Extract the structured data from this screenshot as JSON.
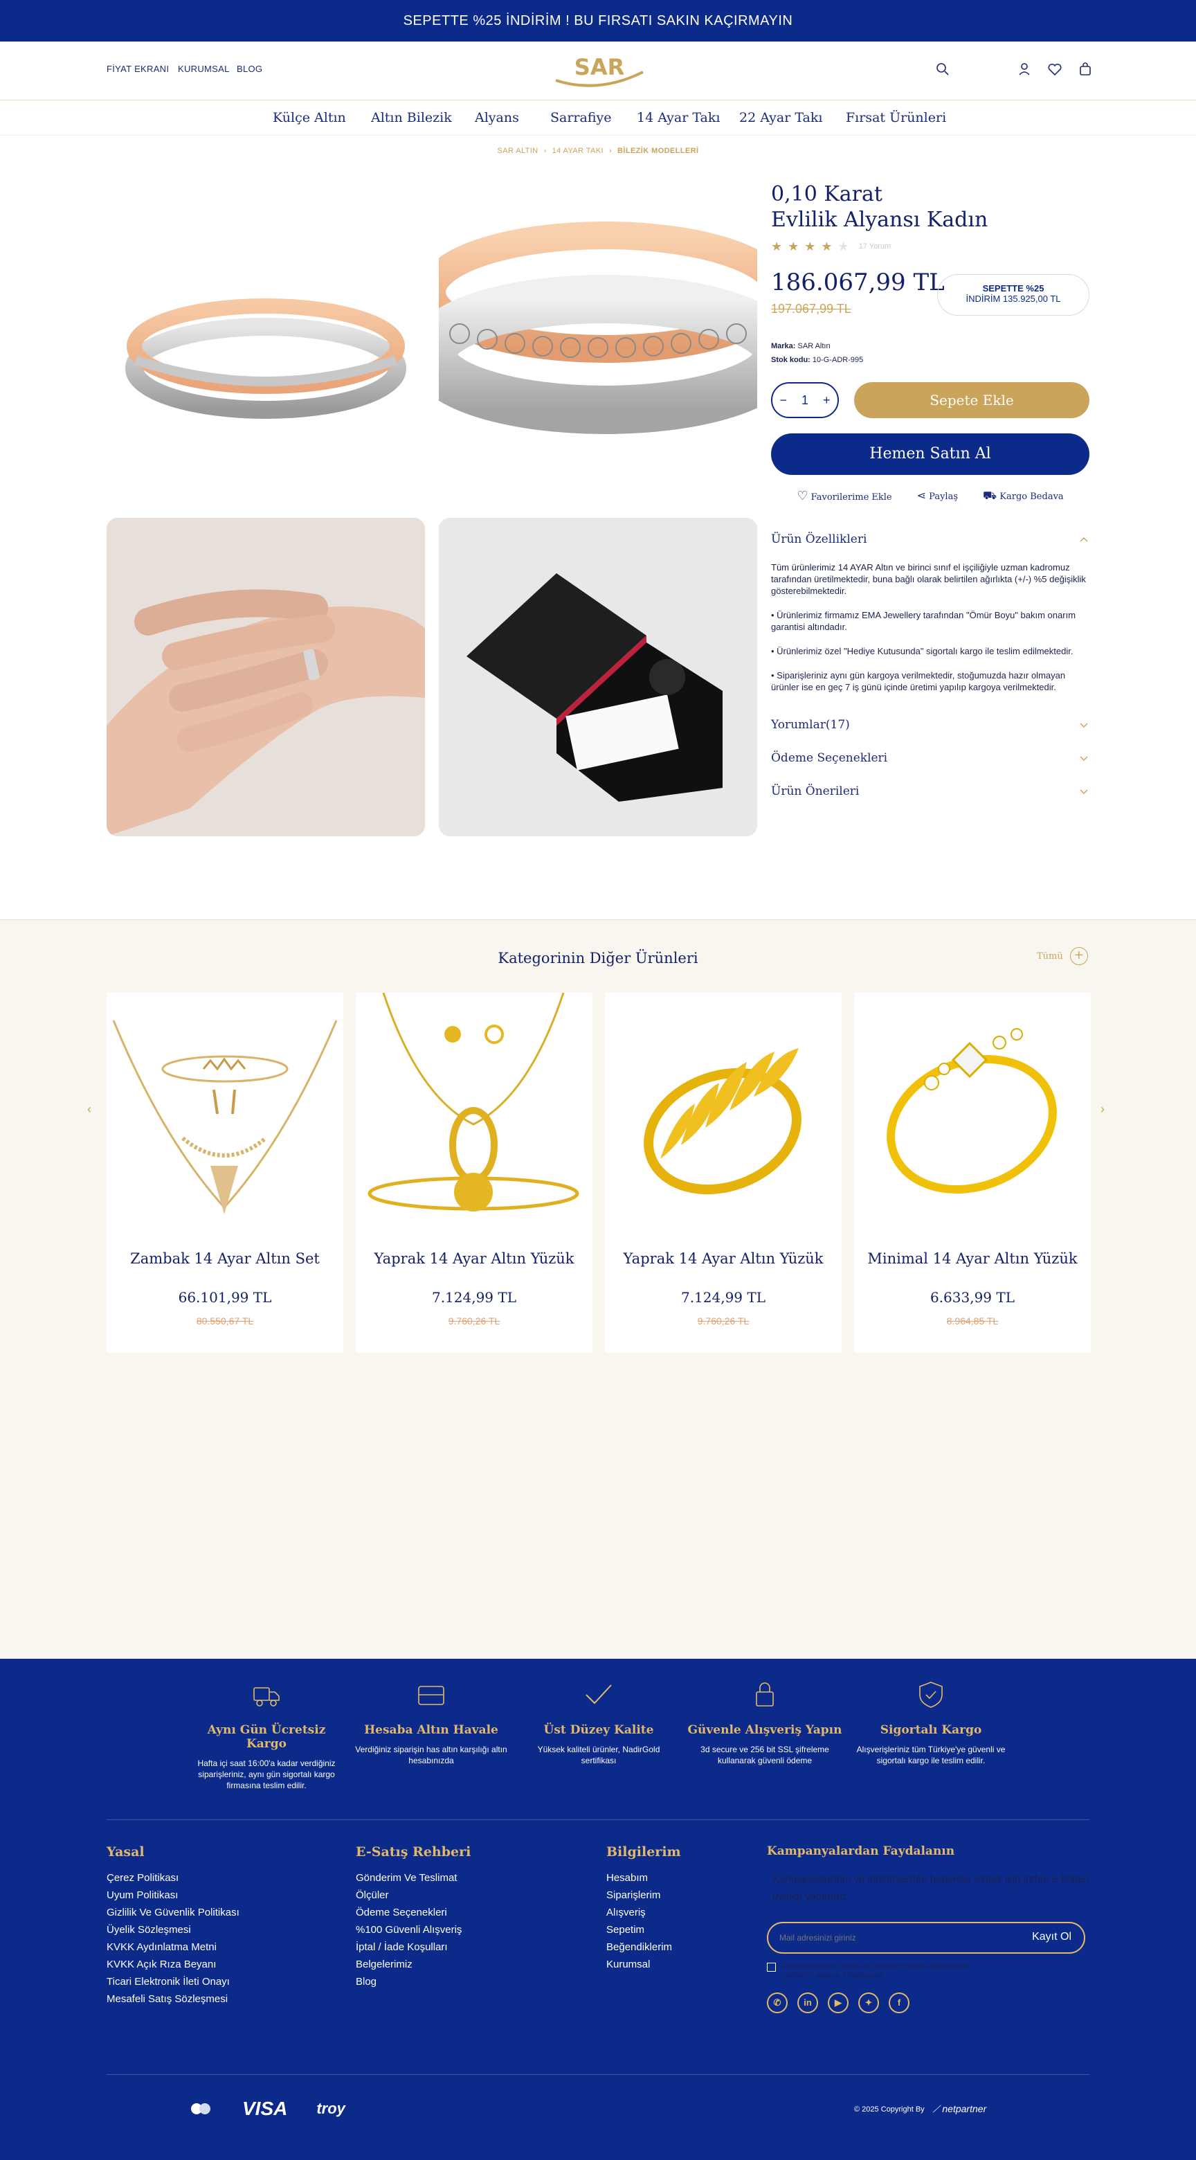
{
  "topbar": {
    "text": "SEPETTE %25 İNDİRİM ! BU FIRSATI SAKIN KAÇIRMAYIN"
  },
  "header": {
    "links": [
      "FİYAT EKRANI",
      "KURUMSAL",
      "BLOG"
    ],
    "logo_text": "SAR"
  },
  "nav": [
    "Külçe Altın",
    "Altın Bilezik",
    "Alyans",
    "Sarrafiye",
    "14 Ayar Takı",
    "22 Ayar Takı",
    "Fırsat Ürünleri"
  ],
  "breadcrumb": [
    "SAR ALTIN",
    "14 AYAR TAKI",
    "BİLEZİK MODELLERİ"
  ],
  "product": {
    "title_line1": "0,10 Karat",
    "title_line2": "Evlilik Alyansı Kadın",
    "rating": 4,
    "review_count": "17 Yorum",
    "price": "186.067,99 TL",
    "old_price": "197.067,99 TL",
    "discount_line1": "SEPETTE %25",
    "discount_line2": "İNDİRİM 135.925,00 TL",
    "brand_label": "Marka:",
    "brand": "SAR Altın",
    "sku_label": "Stok kodu:",
    "sku": "10-G-ADR-995",
    "qty": "1",
    "minus": "−",
    "plus": "+",
    "add_to_cart": "Sepete Ekle",
    "buy_now": "Hemen Satın Al",
    "fav": "Favorilerime Ekle",
    "share": "Paylaş",
    "shipping": "Kargo Bedava"
  },
  "accordion": {
    "features_title": "Ürün Özellikleri",
    "features_paragraphs": [
      "Tüm ürünlerimiz 14 AYAR Altın ve birinci sınıf el işçiliğiyle uzman kadromuz tarafından üretilmektedir, buna bağlı olarak belirtilen ağırlıkta (+/-) %5 değişiklik gösterebilmektedir.",
      "• Ürünlerimiz firmamız EMA Jewellery tarafından \"Ömür Boyu\" bakım onarım garantisi altındadır.",
      "• Ürünlerimiz özel \"Hediye Kutusunda\" sigortalı kargo ile teslim edilmektedir.",
      "• Siparişleriniz aynı gün kargoya verilmektedir, stoğumuzda hazır olmayan ürünler ise en geç 7 iş günü içinde üretimi yapılıp kargoya verilmektedir."
    ],
    "reviews_title": "Yorumlar(17)",
    "payment_title": "Ödeme Seçenekleri",
    "suggestions_title": "Ürün Önerileri"
  },
  "category": {
    "title": "Kategorinin Diğer Ürünleri",
    "all_link": "Tümü",
    "products": [
      {
        "name": "Zambak 14 Ayar Altın Set",
        "price": "66.101,99 TL",
        "old_price": "80.550,67 TL"
      },
      {
        "name": "Yaprak 14 Ayar Altın Yüzük",
        "price": "7.124,99 TL",
        "old_price": "9.760,26 TL"
      },
      {
        "name": "Yaprak 14 Ayar Altın Yüzük",
        "price": "7.124,99 TL",
        "old_price": "9.760,26 TL"
      },
      {
        "name": "Minimal 14 Ayar Altın Yüzük",
        "price": "6.633,99 TL",
        "old_price": "8.964,85 TL"
      }
    ]
  },
  "features": [
    {
      "title": "Aynı Gün Ücretsiz Kargo",
      "desc": "Hafta içi saat 16:00'a kadar verdiğiniz siparişleriniz, aynı gün sigortalı kargo firmasına teslim edilir."
    },
    {
      "title": "Hesaba Altın Havale",
      "desc": "Verdiğiniz siparişin has altın karşılığı altın hesabınızda"
    },
    {
      "title": "Üst Düzey Kalite",
      "desc": "Yüksek kaliteli ürünler, NadirGold sertifikası"
    },
    {
      "title": "Güvenle Alışveriş Yapın",
      "desc": "3d secure ve 256 bit SSL şifreleme kullanarak güvenli ödeme"
    },
    {
      "title": "Sigortalı Kargo",
      "desc": "Alışverişleriniz tüm Türkiye'ye güvenli ve sigortalı kargo ile teslim edilir."
    }
  ],
  "footer": {
    "col1_title": "Yasal",
    "col1": [
      "Çerez Politikası",
      "Uyum Politikası",
      "Gizlilik Ve Güvenlik Politikası",
      "Üyelik Sözleşmesi",
      "KVKK Aydınlatma Metni",
      "KVKK Açık Rıza Beyanı",
      "Ticari Elektronik İleti Onayı",
      "Mesafeli Satış Sözleşmesi"
    ],
    "col2_title": "E-Satış Rehberi",
    "col2": [
      "Gönderim Ve Teslimat",
      "Ölçüler",
      "Ödeme Seçenekleri",
      "%100 Güvenli Alışveriş",
      "İptal / İade Koşulları",
      "Belgelerimiz",
      "Blog"
    ],
    "col3_title": "Bilgilerim",
    "col3": [
      "Hesabım",
      "Siparişlerim",
      "Alışveriş",
      "Sepetim",
      "Beğendiklerim",
      "Kurumsal"
    ],
    "newsletter_title": "Kampanyalardan Faydalanın",
    "newsletter_desc": "Kampanyalardan ve indirimlerden haberdar olmak için lütfen e-bülten üyeliği yaptırınız",
    "email_placeholder": "Mail adresinizi giriniz",
    "subscribe": "Kayıt Ol",
    "consent": "Üyelik sözleşmesi, Gizlilik ve Güvenlik Politikası bilgilendirme metinlerini okudum. Onaylıyorum.",
    "payments": [
      "VISA",
      "troy"
    ],
    "copyright": "© 2025 Copyright By",
    "partner": "netpartner"
  }
}
